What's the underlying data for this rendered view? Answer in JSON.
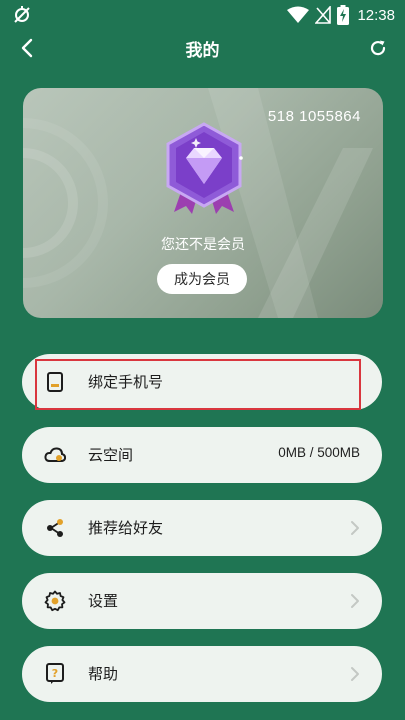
{
  "status_bar": {
    "time": "12:38",
    "icons": [
      "no-sim-icon",
      "wifi-icon",
      "signal-off-icon",
      "battery-charging-icon"
    ]
  },
  "header": {
    "title": "我的",
    "back_icon": "back-arrow-icon",
    "refresh_icon": "refresh-icon"
  },
  "member_card": {
    "member_id": "518 1055864",
    "status_text": "您还不是会员",
    "cta_label": "成为会员",
    "badge_icon": "diamond-badge-icon"
  },
  "menu": {
    "items": [
      {
        "label": "绑定手机号",
        "icon": "phone-icon",
        "value": "",
        "highlighted": true
      },
      {
        "label": "云空间",
        "icon": "cloud-icon",
        "value": "0MB / 500MB"
      },
      {
        "label": "推荐给好友",
        "icon": "share-icon",
        "value": ""
      },
      {
        "label": "设置",
        "icon": "gear-icon",
        "value": ""
      },
      {
        "label": "帮助",
        "icon": "help-icon",
        "value": ""
      }
    ]
  },
  "colors": {
    "background": "#1f7553",
    "item_background": "#eef3ef",
    "highlight_border": "#d9363e",
    "icon_accent": "#e2a12a"
  }
}
